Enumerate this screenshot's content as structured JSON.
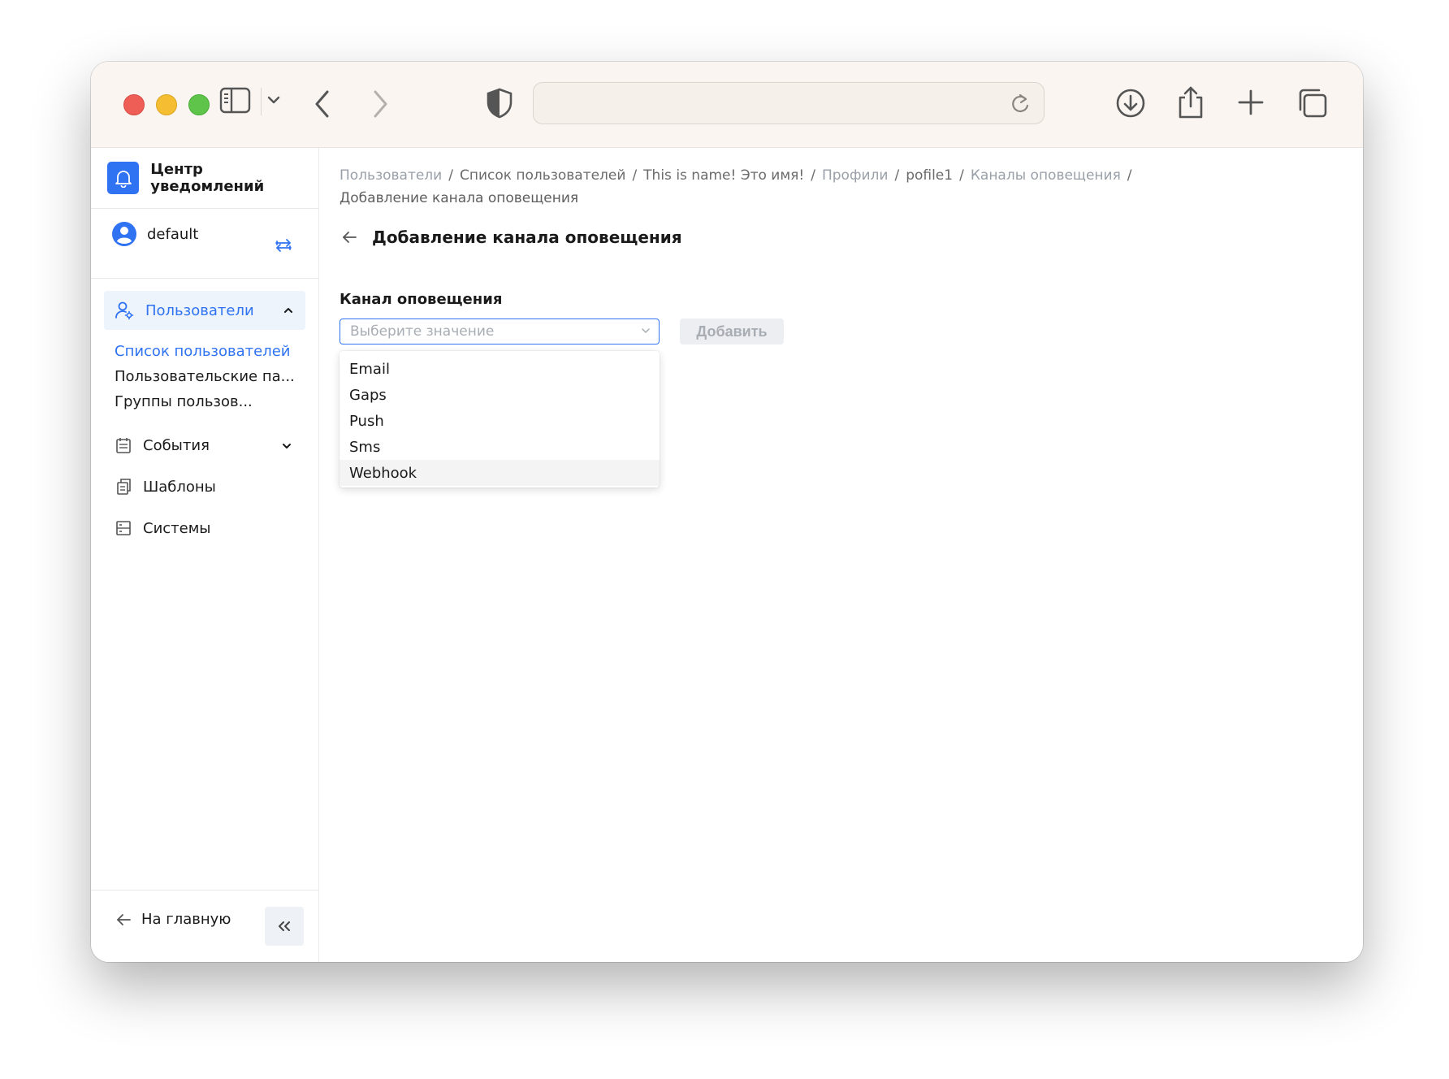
{
  "app": {
    "title": "Центр уведомлений",
    "account": "default"
  },
  "sidebar": {
    "users": {
      "label": "Пользователи",
      "children": [
        "Список пользователей",
        "Пользовательские па...",
        "Группы пользов..."
      ]
    },
    "items": [
      {
        "label": "События",
        "icon": "calendar-icon"
      },
      {
        "label": "Шаблоны",
        "icon": "copy-icon"
      },
      {
        "label": "Системы",
        "icon": "list-icon"
      }
    ],
    "home": "На главную"
  },
  "breadcrumb": [
    {
      "label": "Пользователи"
    },
    {
      "label": "Список пользователей"
    },
    {
      "label": "This is name! Это имя!"
    },
    {
      "label": "Профили"
    },
    {
      "label": "pofile1"
    },
    {
      "label": "Каналы оповещения"
    },
    {
      "label": "Добавление канала оповещения"
    }
  ],
  "page": {
    "title": "Добавление канала оповещения"
  },
  "form": {
    "field_label": "Канал оповещения",
    "placeholder": "Выберите значение",
    "add_button": "Добавить",
    "options": [
      "Email",
      "Gaps",
      "Push",
      "Sms",
      "Webhook"
    ],
    "hovered_option": "Webhook"
  },
  "colors": {
    "accent": "#2f73f2",
    "toolbar_bg": "#faf5f1"
  }
}
